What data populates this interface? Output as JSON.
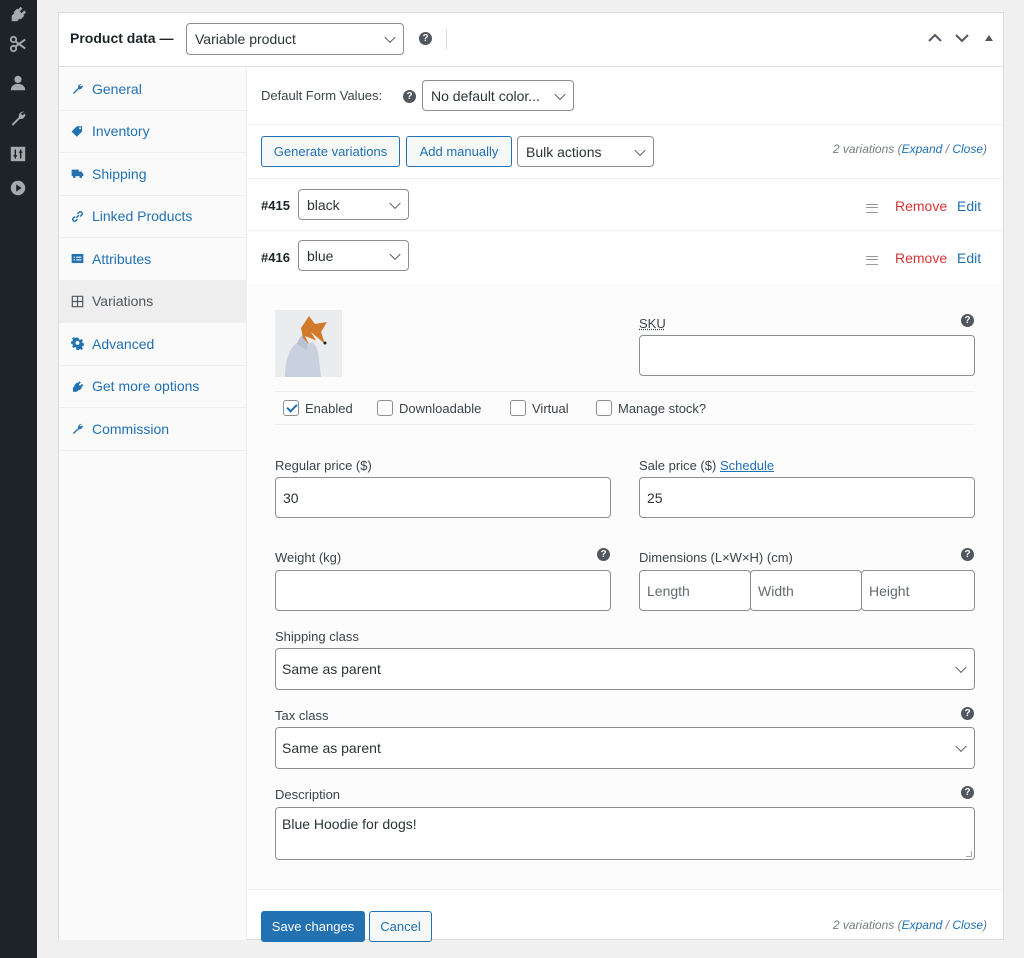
{
  "admin_sidebar": {
    "icons": [
      "plugins-icon",
      "tools-scissors-icon",
      "users-icon",
      "wrench-icon",
      "settings-sliders-icon",
      "play-circle-icon"
    ]
  },
  "product_data": {
    "title": "Product data —",
    "type_select": "Variable product",
    "header_controls": [
      "move-up-icon",
      "move-down-icon",
      "collapse-toggle-icon"
    ]
  },
  "tabs": [
    {
      "label": "General",
      "icon": "wrench-icon",
      "active": false
    },
    {
      "label": "Inventory",
      "icon": "tag-icon",
      "active": false
    },
    {
      "label": "Shipping",
      "icon": "truck-icon",
      "active": false
    },
    {
      "label": "Linked Products",
      "icon": "link-icon",
      "active": false
    },
    {
      "label": "Attributes",
      "icon": "list-card-icon",
      "active": false
    },
    {
      "label": "Variations",
      "icon": "grid-icon",
      "active": true
    },
    {
      "label": "Advanced",
      "icon": "gear-icon",
      "active": false
    },
    {
      "label": "Get more options",
      "icon": "plug-icon",
      "active": false
    },
    {
      "label": "Commission",
      "icon": "wrench-icon",
      "active": false
    }
  ],
  "variations": {
    "default_form_label": "Default Form Values:",
    "default_form_value": "No default color...",
    "generate_label": "Generate variations",
    "add_manually_label": "Add manually",
    "bulk_actions_label": "Bulk actions",
    "count_text": "2 variations",
    "expand_label": "Expand",
    "close_label": "Close",
    "list": [
      {
        "id": "#415",
        "value": "black",
        "remove": "Remove",
        "edit": "Edit"
      },
      {
        "id": "#416",
        "value": "blue",
        "remove": "Remove",
        "edit": "Edit"
      }
    ]
  },
  "variation_form": {
    "sku_label": "SKU",
    "sku_value": "",
    "checkboxes": [
      {
        "label": "Enabled",
        "checked": true
      },
      {
        "label": "Downloadable",
        "checked": false
      },
      {
        "label": "Virtual",
        "checked": false
      },
      {
        "label": "Manage stock?",
        "checked": false
      }
    ],
    "regular_price_label": "Regular price ($)",
    "regular_price_value": "30",
    "sale_price_label": "Sale price ($)",
    "schedule_link": "Schedule",
    "sale_price_value": "25",
    "weight_label": "Weight (kg)",
    "weight_value": "",
    "dimensions_label": "Dimensions (L×W×H) (cm)",
    "length_placeholder": "Length",
    "width_placeholder": "Width",
    "height_placeholder": "Height",
    "shipping_class_label": "Shipping class",
    "shipping_class_value": "Same as parent",
    "tax_class_label": "Tax class",
    "tax_class_value": "Same as parent",
    "description_label": "Description",
    "description_value": "Blue Hoodie for dogs!"
  },
  "footer": {
    "save_label": "Save changes",
    "cancel_label": "Cancel"
  },
  "help_glyph": "?"
}
